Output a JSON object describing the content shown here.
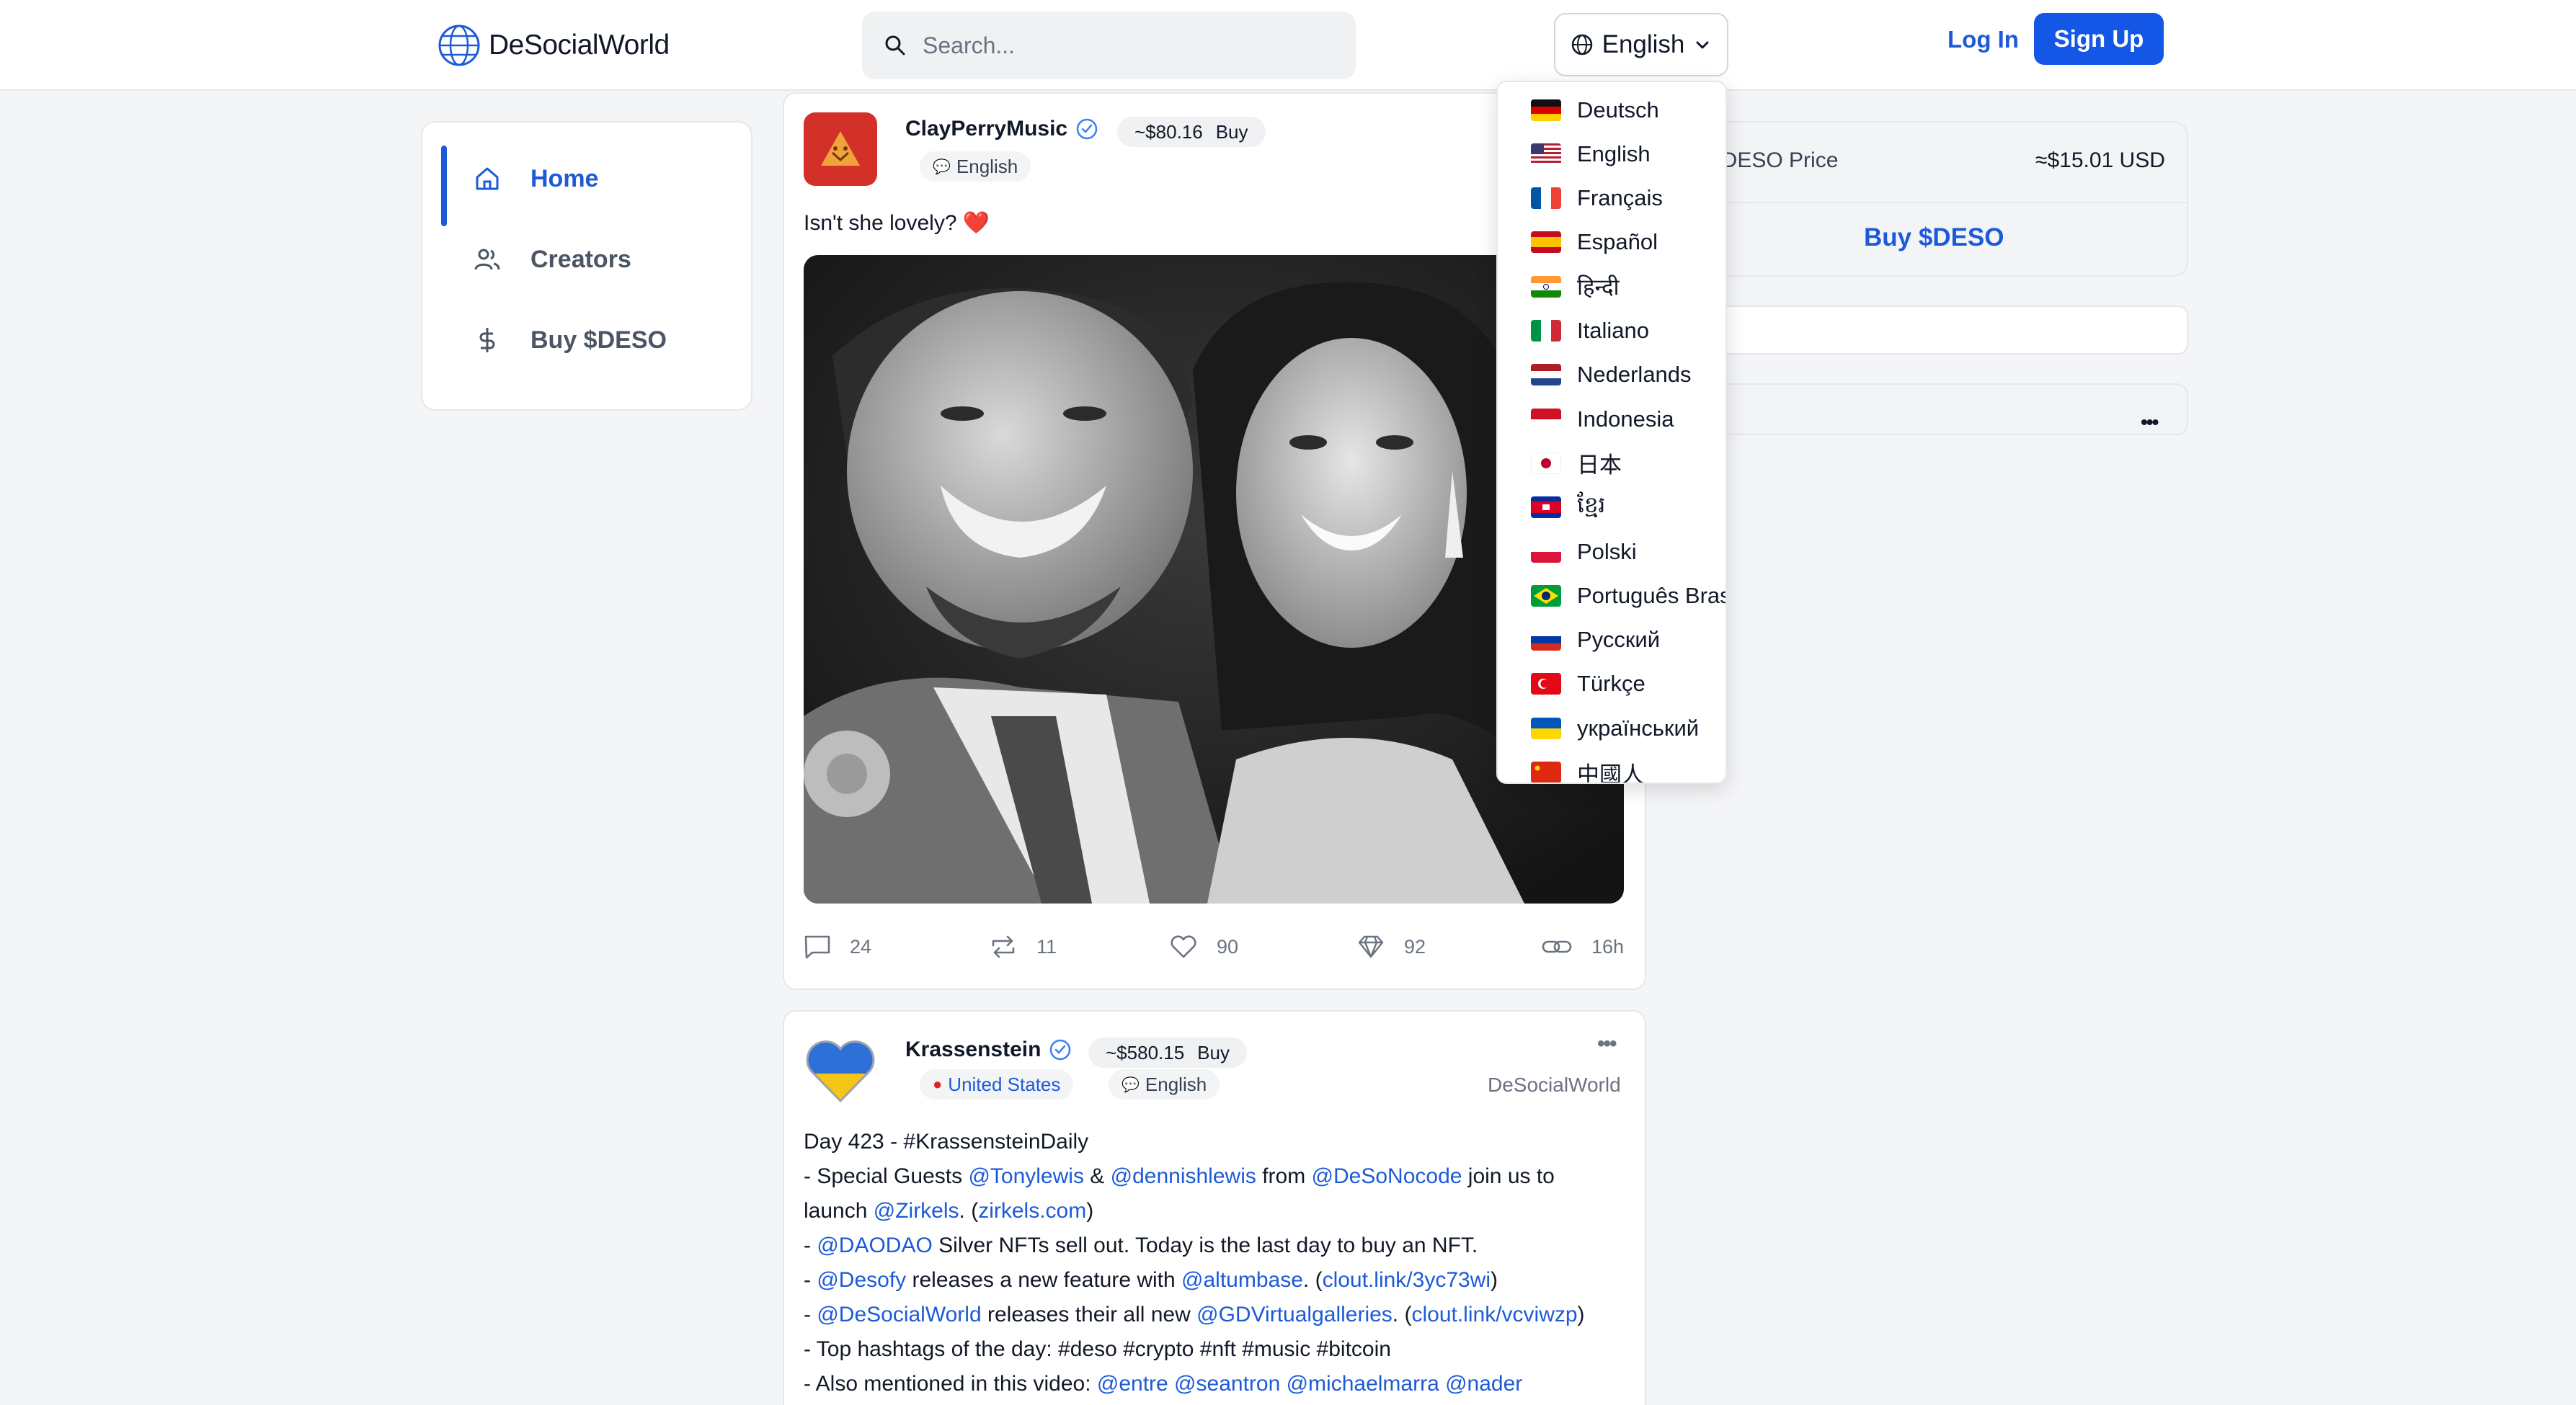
{
  "header": {
    "brand": "DeSocialWorld",
    "search_placeholder": "Search...",
    "language_button": "English",
    "login_label": "Log In",
    "signup_label": "Sign Up"
  },
  "sidebar": {
    "items": [
      {
        "label": "Home",
        "icon": "home-icon",
        "active": true
      },
      {
        "label": "Creators",
        "icon": "users-icon",
        "active": false
      },
      {
        "label": "Buy $DESO",
        "icon": "dollar-icon",
        "active": false
      }
    ]
  },
  "language_menu": {
    "items": [
      {
        "label": "Deutsch",
        "flag": "de"
      },
      {
        "label": "English",
        "flag": "us"
      },
      {
        "label": "Français",
        "flag": "fr"
      },
      {
        "label": "Español",
        "flag": "es"
      },
      {
        "label": "हिन्दी",
        "flag": "in"
      },
      {
        "label": "Italiano",
        "flag": "it"
      },
      {
        "label": "Nederlands",
        "flag": "nl"
      },
      {
        "label": "Indonesia",
        "flag": "id"
      },
      {
        "label": "日本",
        "flag": "jp"
      },
      {
        "label": "ខ្មែរ",
        "flag": "kh"
      },
      {
        "label": "Polski",
        "flag": "pl"
      },
      {
        "label": "Português Bras",
        "flag": "br"
      },
      {
        "label": "Русский",
        "flag": "ru"
      },
      {
        "label": "Türkçe",
        "flag": "tr"
      },
      {
        "label": "український",
        "flag": "ua"
      },
      {
        "label": "中國人",
        "flag": "cn"
      }
    ]
  },
  "right_sidebar": {
    "price_label": "$DESO Price",
    "price_value": "≈$15.01 USD",
    "buy_label": "Buy $DESO",
    "more_label": "•••"
  },
  "posts": [
    {
      "username": "ClayPerryMusic",
      "verified": true,
      "coin_price": "~$80.16",
      "buy_label": "Buy",
      "language_tag": "English",
      "text": "Isn't she lovely? ❤️",
      "comments": "24",
      "reposts": "11",
      "likes": "90",
      "diamonds": "92",
      "time": "16h"
    },
    {
      "username": "Krassenstein",
      "verified": true,
      "coin_price": "~$580.15",
      "buy_label": "Buy",
      "location_tag": "United States",
      "language_tag": "English",
      "app_label": "DeSocialWorld",
      "more_label": "•••",
      "lines": [
        [
          {
            "t": "Day 423 - #KrassensteinDaily"
          }
        ],
        [
          {
            "t": "- Special Guests "
          },
          {
            "t": "@Tonylewis",
            "link": true
          },
          {
            "t": " & "
          },
          {
            "t": "@dennishlewis",
            "link": true
          },
          {
            "t": " from "
          },
          {
            "t": "@DeSoNocode",
            "link": true
          },
          {
            "t": " join us to"
          }
        ],
        [
          {
            "t": "launch "
          },
          {
            "t": "@Zirkels",
            "link": true
          },
          {
            "t": ". ("
          },
          {
            "t": "zirkels.com",
            "link": true
          },
          {
            "t": ")"
          }
        ],
        [
          {
            "t": "- "
          },
          {
            "t": "@DAODAO",
            "link": true
          },
          {
            "t": " Silver NFTs sell out. Today is the last day to buy an NFT."
          }
        ],
        [
          {
            "t": "- "
          },
          {
            "t": "@Desofy",
            "link": true
          },
          {
            "t": " releases a new feature with "
          },
          {
            "t": "@altumbase",
            "link": true
          },
          {
            "t": ". ("
          },
          {
            "t": "clout.link/3yc73wi",
            "link": true
          },
          {
            "t": ")"
          }
        ],
        [
          {
            "t": "- "
          },
          {
            "t": "@DeSocialWorld",
            "link": true
          },
          {
            "t": " releases their all new "
          },
          {
            "t": "@GDVirtualgalleries",
            "link": true
          },
          {
            "t": ". ("
          },
          {
            "t": "clout.link/vcviwzp",
            "link": true
          },
          {
            "t": ")"
          }
        ],
        [
          {
            "t": "- Top hashtags of the day: #deso #crypto #nft #music #bitcoin"
          }
        ],
        [
          {
            "t": "- Also mentioned in this video: "
          },
          {
            "t": "@entre @seantron @michaelmarra @nader",
            "link": true
          }
        ]
      ]
    }
  ],
  "colors": {
    "accent": "#1457e6",
    "link": "#1d5ad8",
    "background": "#f4f5f7"
  }
}
